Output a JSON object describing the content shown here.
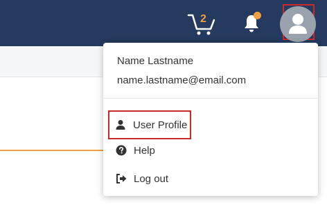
{
  "header": {
    "cart": {
      "icon": "cart-icon",
      "badge_count": "2",
      "badge_color": "#f0a040"
    },
    "notifications": {
      "icon": "bell-icon",
      "indicator_color": "#f0a040"
    },
    "user_avatar": {
      "icon": "user-avatar-icon",
      "highlight_color": "#cc2a2a"
    },
    "background_color": "#243a5e"
  },
  "user_menu": {
    "name": "Name Lastname",
    "email": "name.lastname@email.com",
    "items": [
      {
        "label": "User Profile",
        "icon": "user-icon",
        "highlighted": true
      },
      {
        "label": "Help",
        "icon": "question-circle-icon"
      },
      {
        "label": "Log out",
        "icon": "sign-out-icon"
      }
    ]
  }
}
